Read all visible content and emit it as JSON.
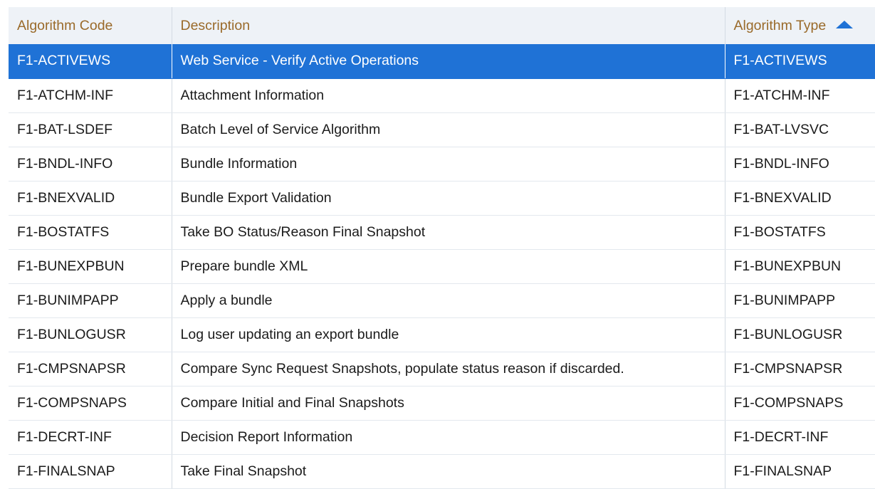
{
  "table": {
    "columns": [
      "Algorithm Code",
      "Description",
      "Algorithm Type"
    ],
    "sort": {
      "column": "Algorithm Type",
      "direction": "ascending",
      "icon": "triangle-up-icon"
    },
    "selected_row": 0,
    "accent_color": "#1f72d6",
    "header_text_color": "#9a6a2a",
    "rows": [
      {
        "code": "F1-ACTIVEWS",
        "description": "Web Service - Verify Active Operations",
        "type": "F1-ACTIVEWS"
      },
      {
        "code": "F1-ATCHM-INF",
        "description": "Attachment Information",
        "type": "F1-ATCHM-INF"
      },
      {
        "code": "F1-BAT-LSDEF",
        "description": "Batch Level of Service Algorithm",
        "type": "F1-BAT-LVSVC"
      },
      {
        "code": "F1-BNDL-INFO",
        "description": "Bundle Information",
        "type": "F1-BNDL-INFO"
      },
      {
        "code": "F1-BNEXVALID",
        "description": "Bundle Export Validation",
        "type": "F1-BNEXVALID"
      },
      {
        "code": "F1-BOSTATFS",
        "description": "Take BO Status/Reason Final Snapshot",
        "type": "F1-BOSTATFS"
      },
      {
        "code": "F1-BUNEXPBUN",
        "description": "Prepare bundle XML",
        "type": "F1-BUNEXPBUN"
      },
      {
        "code": "F1-BUNIMPAPP",
        "description": "Apply a bundle",
        "type": "F1-BUNIMPAPP"
      },
      {
        "code": "F1-BUNLOGUSR",
        "description": "Log user updating an export bundle",
        "type": "F1-BUNLOGUSR"
      },
      {
        "code": "F1-CMPSNAPSR",
        "description": "Compare Sync Request Snapshots, populate status reason if discarded.",
        "type": "F1-CMPSNAPSR"
      },
      {
        "code": "F1-COMPSNAPS",
        "description": "Compare Initial and Final Snapshots",
        "type": "F1-COMPSNAPS"
      },
      {
        "code": "F1-DECRT-INF",
        "description": "Decision Report Information",
        "type": "F1-DECRT-INF"
      },
      {
        "code": "F1-FINALSNAP",
        "description": "Take Final Snapshot",
        "type": "F1-FINALSNAP"
      }
    ]
  }
}
